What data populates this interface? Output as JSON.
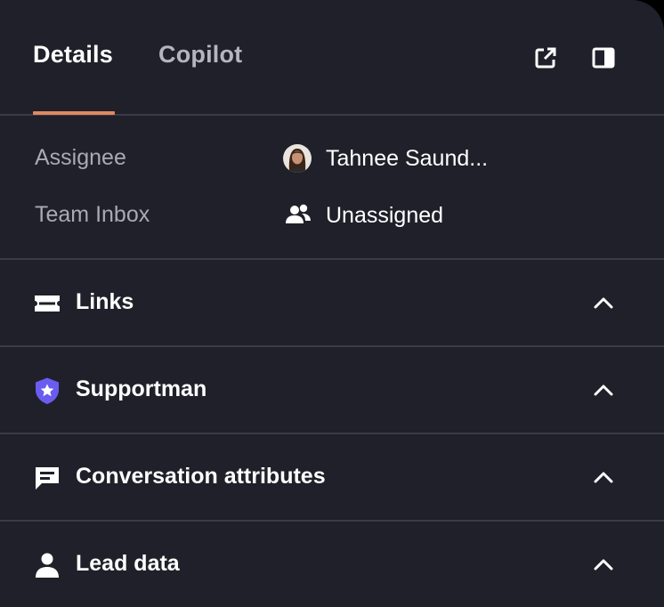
{
  "tabs": [
    {
      "label": "Details",
      "active": true
    },
    {
      "label": "Copilot",
      "active": false
    }
  ],
  "header_icons": [
    "external-link-icon",
    "sidebar-toggle-icon"
  ],
  "details": {
    "assignee_label": "Assignee",
    "assignee_value": "Tahnee Saund...",
    "team_inbox_label": "Team Inbox",
    "team_inbox_value": "Unassigned"
  },
  "sections": [
    {
      "title": "Links",
      "icon": "ticket-icon"
    },
    {
      "title": "Supportman",
      "icon": "shield-star-icon"
    },
    {
      "title": "Conversation attributes",
      "icon": "chat-icon"
    },
    {
      "title": "Lead data",
      "icon": "person-icon"
    }
  ],
  "colors": {
    "background": "#1f2029",
    "divider": "#3a3b44",
    "accent_underline": "#e0895f",
    "muted_text": "#a9aab2",
    "supportman_shield": "#6b5cf0"
  }
}
